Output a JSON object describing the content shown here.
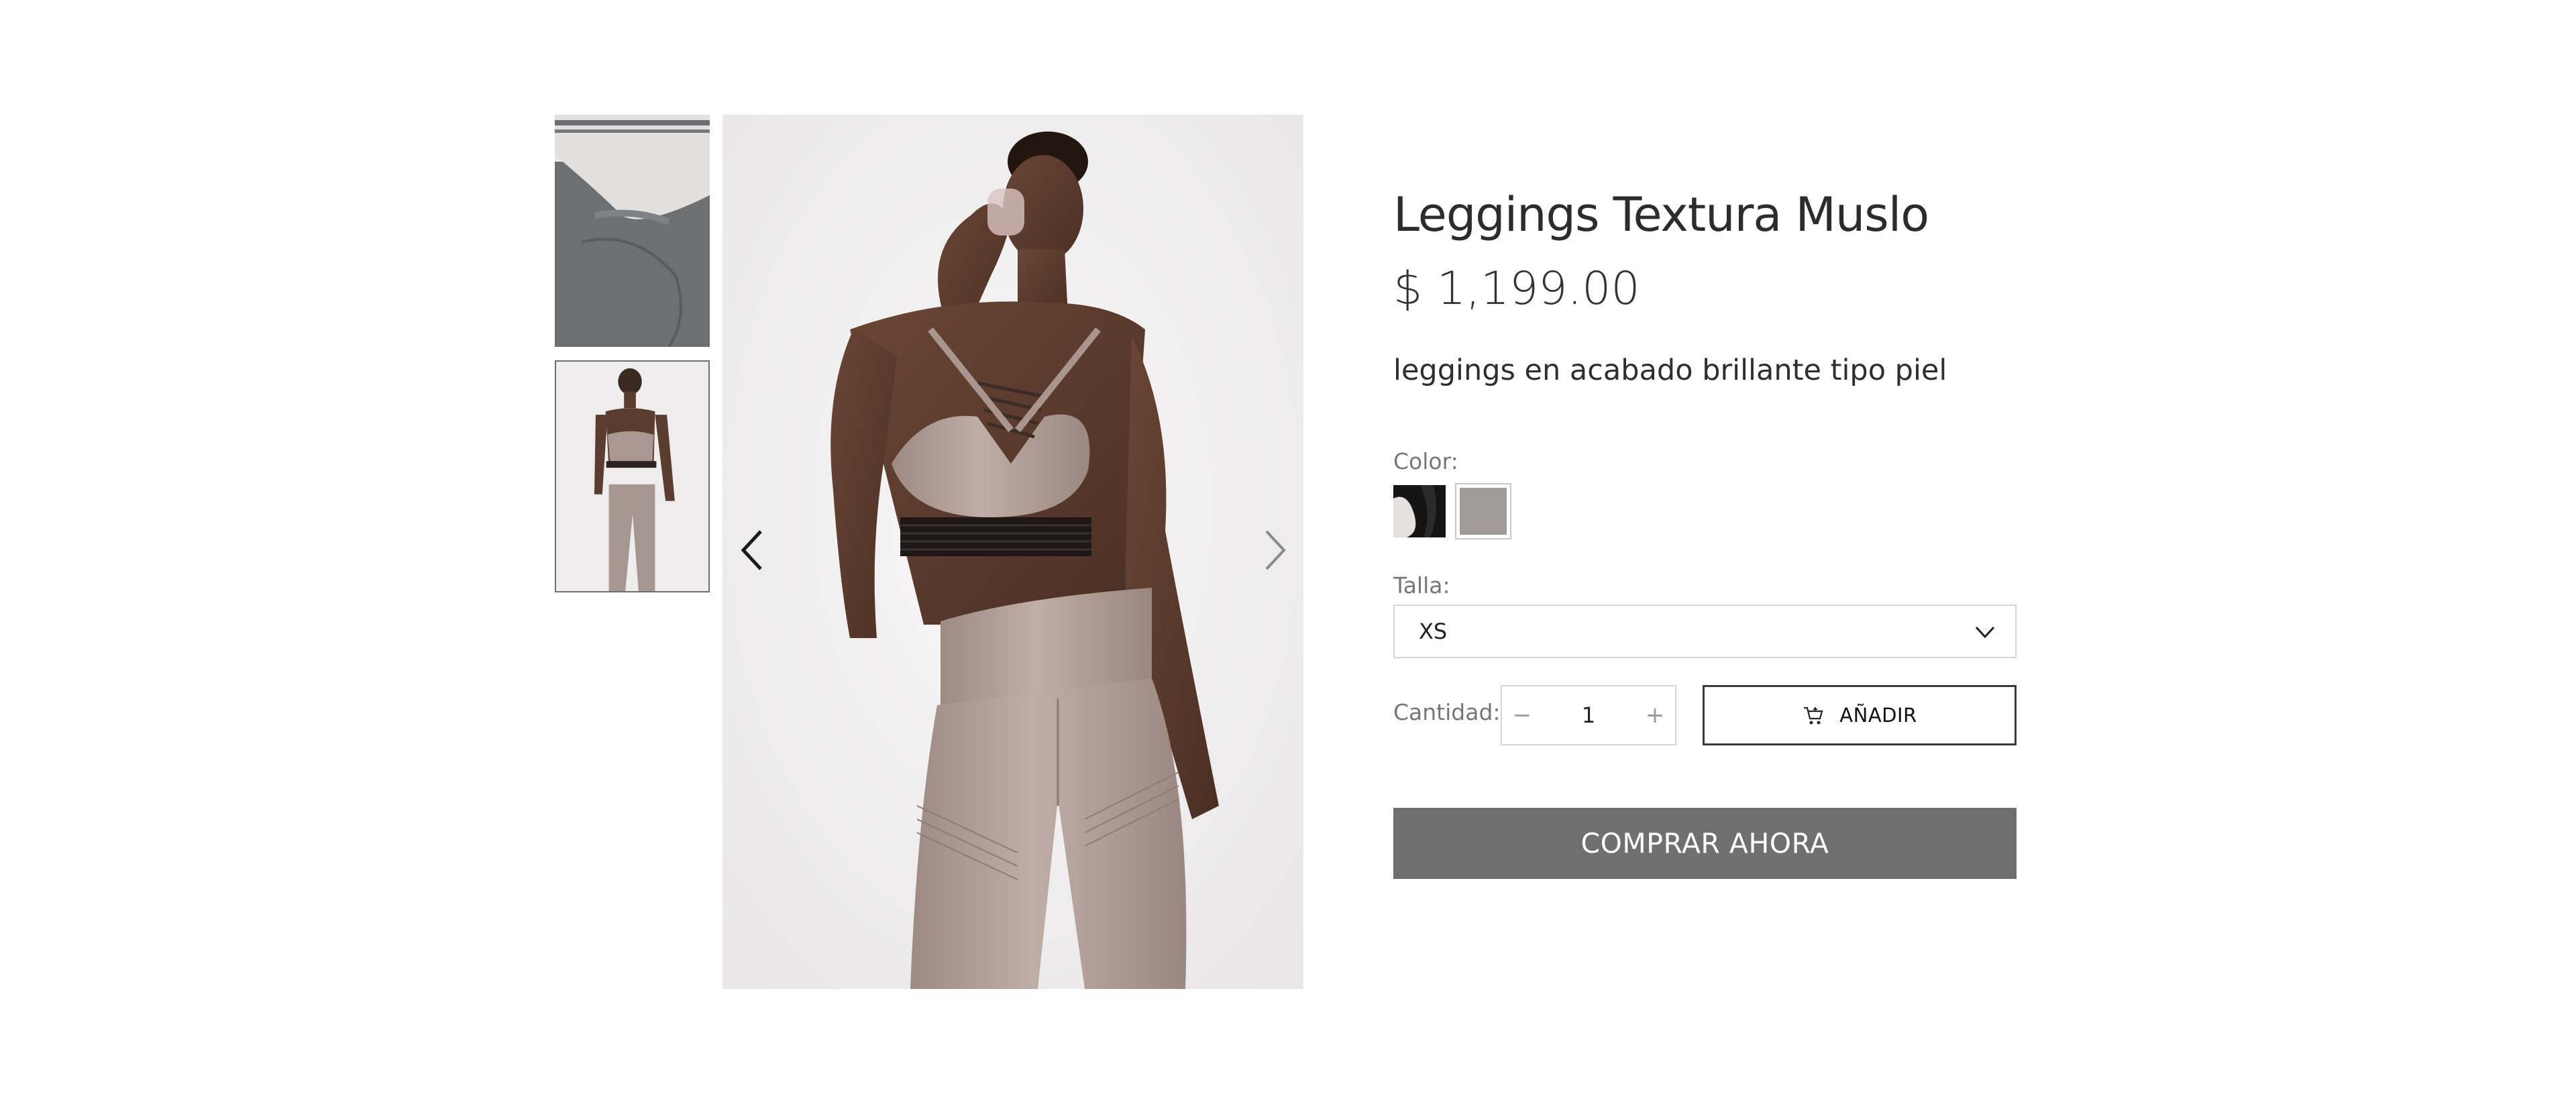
{
  "gallery": {
    "thumbnails": [
      {
        "alt": "detail-back-view"
      },
      {
        "alt": "model-front-view"
      }
    ],
    "selected_index": 1,
    "prev_icon": "chevron-left-icon",
    "next_icon": "chevron-right-icon"
  },
  "product": {
    "title": "Leggings Textura Muslo",
    "price": "$ 1,199.00",
    "description": "leggings en acabado brillante tipo piel"
  },
  "options": {
    "color_label": "Color:",
    "colors": [
      {
        "name": "black",
        "hex": "#141414"
      },
      {
        "name": "taupe",
        "hex": "#a29a96"
      }
    ],
    "selected_color": "taupe",
    "size_label": "Talla:",
    "size_value": "XS",
    "quantity_label": "Cantidad:",
    "quantity_value": "1",
    "minus_symbol": "−",
    "plus_symbol": "+"
  },
  "actions": {
    "add_label": "AÑADIR",
    "add_icon": "cart-icon",
    "buy_label": "COMPRAR AHORA"
  },
  "colors": {
    "buy_button_bg": "#6f6f6f",
    "text_primary": "#2c2c2c"
  }
}
